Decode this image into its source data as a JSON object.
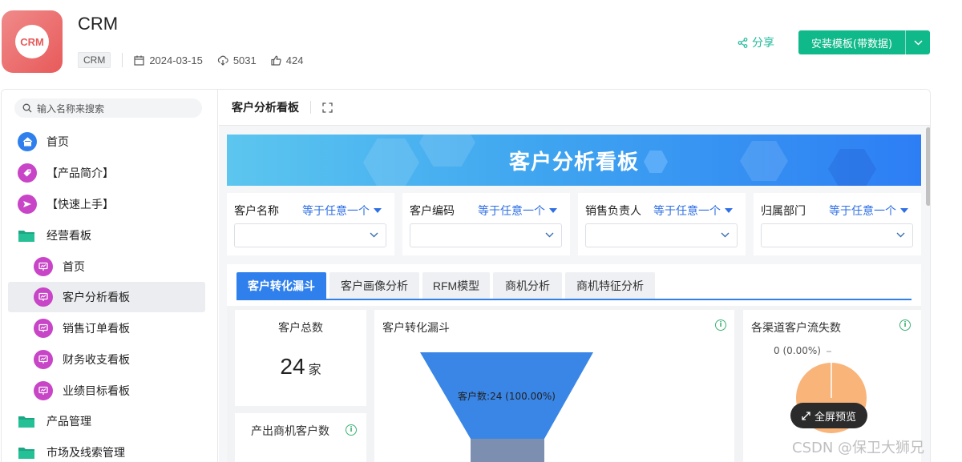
{
  "header": {
    "logo_text": "CRM",
    "title": "CRM",
    "tag": "CRM",
    "date": "2024-03-15",
    "downloads": "5031",
    "likes": "424",
    "share_label": "分享",
    "install_label": "安装模板(带数据)"
  },
  "sidebar": {
    "search_placeholder": "输入名称来搜索",
    "items": [
      {
        "label": "首页",
        "icon": "home-icon"
      },
      {
        "label": "【产品简介】",
        "icon": "tag-icon"
      },
      {
        "label": "【快速上手】",
        "icon": "send-icon"
      },
      {
        "label": "经营看板",
        "icon": "folder-icon"
      },
      {
        "label": "首页",
        "icon": "dashboard-icon"
      },
      {
        "label": "客户分析看板",
        "icon": "dashboard-icon"
      },
      {
        "label": "销售订单看板",
        "icon": "dashboard-icon"
      },
      {
        "label": "财务收支看板",
        "icon": "dashboard-icon"
      },
      {
        "label": "业绩目标看板",
        "icon": "dashboard-icon"
      },
      {
        "label": "产品管理",
        "icon": "folder-icon"
      },
      {
        "label": "市场及线索管理",
        "icon": "folder-icon"
      }
    ]
  },
  "main": {
    "page_title": "客户分析看板",
    "banner_title": "客户分析看板",
    "filters": [
      {
        "label": "客户名称",
        "operator": "等于任意一个"
      },
      {
        "label": "客户编码",
        "operator": "等于任意一个"
      },
      {
        "label": "销售负责人",
        "operator": "等于任意一个"
      },
      {
        "label": "归属部门",
        "operator": "等于任意一个"
      }
    ],
    "tabs": [
      "客户转化漏斗",
      "客户画像分析",
      "RFM模型",
      "商机分析",
      "商机特征分析"
    ],
    "cards": {
      "total_title": "客户总数",
      "total_value": "24",
      "total_unit": "家",
      "opportunity_title": "产出商机客户数",
      "funnel_title": "客户转化漏斗",
      "funnel_label": "客户数:24 (100.00%)",
      "churn_title": "各渠道客户流失数",
      "churn_label": "0 (0.00%)"
    },
    "fullscreen_label": "全屏预览"
  },
  "watermark": "CSDN @保卫大狮兄",
  "colors": {
    "accent": "#10b98a",
    "primary_blue": "#2f80ed",
    "funnel_blue": "#3a86e6",
    "funnel_gray": "#7d8fb0",
    "pie_orange": "#f9b47a"
  }
}
